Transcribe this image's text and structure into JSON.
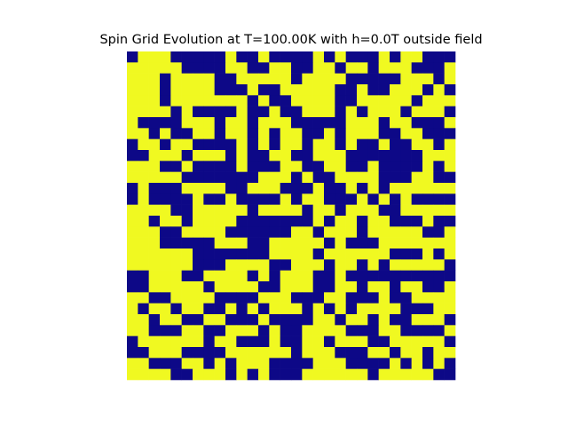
{
  "chart_data": {
    "type": "heatmap",
    "title": "Spin Grid Evolution at T=100.00K with h=0.0T outside field",
    "xlabel": "",
    "ylabel": "",
    "grid": false,
    "legend": "none",
    "axes_visible": false,
    "rows": 30,
    "cols": 30,
    "value_encoding": {
      "1": "spin up",
      "-1": "spin down"
    },
    "colors": {
      "1": "#f0f921",
      "-1": "#0d0887"
    },
    "values": [
      [
        -1,
        1,
        1,
        1,
        -1,
        -1,
        -1,
        -1,
        -1,
        1,
        -1,
        -1,
        1,
        -1,
        -1,
        -1,
        -1,
        1,
        -1,
        1,
        -1,
        -1,
        -1,
        1,
        -1,
        1,
        1,
        -1,
        -1,
        -1
      ],
      [
        1,
        1,
        1,
        1,
        1,
        -1,
        -1,
        -1,
        -1,
        1,
        1,
        -1,
        -1,
        1,
        1,
        -1,
        -1,
        1,
        1,
        -1,
        1,
        1,
        -1,
        1,
        1,
        1,
        -1,
        -1,
        -1,
        1
      ],
      [
        1,
        1,
        1,
        -1,
        1,
        1,
        1,
        1,
        -1,
        -1,
        1,
        1,
        1,
        1,
        1,
        -1,
        1,
        1,
        1,
        1,
        -1,
        -1,
        -1,
        -1,
        -1,
        1,
        1,
        1,
        -1,
        1
      ],
      [
        1,
        1,
        1,
        -1,
        1,
        1,
        1,
        1,
        -1,
        -1,
        -1,
        1,
        -1,
        -1,
        1,
        1,
        1,
        1,
        1,
        -1,
        -1,
        1,
        -1,
        -1,
        1,
        1,
        1,
        -1,
        1,
        -1
      ],
      [
        1,
        1,
        1,
        -1,
        1,
        1,
        1,
        1,
        1,
        1,
        1,
        -1,
        1,
        -1,
        -1,
        1,
        1,
        1,
        1,
        -1,
        -1,
        1,
        1,
        1,
        1,
        1,
        -1,
        1,
        1,
        1
      ],
      [
        1,
        1,
        1,
        1,
        -1,
        1,
        -1,
        -1,
        -1,
        -1,
        1,
        -1,
        -1,
        1,
        -1,
        -1,
        1,
        1,
        1,
        -1,
        1,
        -1,
        1,
        1,
        1,
        -1,
        1,
        1,
        1,
        -1
      ],
      [
        1,
        -1,
        -1,
        -1,
        -1,
        1,
        1,
        1,
        -1,
        1,
        1,
        -1,
        1,
        1,
        1,
        -1,
        -1,
        -1,
        -1,
        -1,
        1,
        1,
        1,
        -1,
        1,
        1,
        -1,
        -1,
        -1,
        1
      ],
      [
        1,
        1,
        -1,
        1,
        -1,
        -1,
        1,
        1,
        -1,
        1,
        1,
        -1,
        1,
        -1,
        1,
        1,
        -1,
        -1,
        1,
        -1,
        1,
        1,
        1,
        -1,
        -1,
        1,
        1,
        -1,
        -1,
        -1
      ],
      [
        -1,
        1,
        1,
        -1,
        1,
        1,
        -1,
        -1,
        -1,
        -1,
        1,
        -1,
        1,
        -1,
        1,
        1,
        -1,
        1,
        1,
        -1,
        1,
        -1,
        -1,
        1,
        -1,
        -1,
        1,
        1,
        -1,
        1
      ],
      [
        -1,
        -1,
        1,
        1,
        1,
        -1,
        1,
        1,
        1,
        -1,
        1,
        -1,
        -1,
        1,
        1,
        -1,
        -1,
        1,
        1,
        1,
        -1,
        -1,
        -1,
        -1,
        -1,
        -1,
        -1,
        1,
        1,
        1
      ],
      [
        1,
        1,
        1,
        -1,
        -1,
        1,
        -1,
        -1,
        -1,
        -1,
        1,
        -1,
        -1,
        -1,
        1,
        1,
        -1,
        -1,
        1,
        1,
        -1,
        -1,
        1,
        -1,
        -1,
        -1,
        -1,
        1,
        -1,
        1
      ],
      [
        1,
        1,
        1,
        1,
        1,
        -1,
        -1,
        -1,
        -1,
        -1,
        -1,
        -1,
        1,
        1,
        1,
        -1,
        1,
        -1,
        -1,
        1,
        1,
        1,
        1,
        -1,
        -1,
        -1,
        1,
        1,
        -1,
        -1
      ],
      [
        -1,
        1,
        -1,
        -1,
        -1,
        1,
        1,
        1,
        1,
        -1,
        -1,
        1,
        1,
        1,
        -1,
        -1,
        -1,
        1,
        -1,
        -1,
        1,
        -1,
        1,
        -1,
        1,
        1,
        1,
        1,
        1,
        1
      ],
      [
        -1,
        1,
        -1,
        -1,
        -1,
        -1,
        1,
        -1,
        -1,
        1,
        -1,
        -1,
        -1,
        -1,
        1,
        -1,
        1,
        1,
        -1,
        -1,
        -1,
        1,
        -1,
        1,
        -1,
        1,
        -1,
        -1,
        -1,
        -1
      ],
      [
        1,
        1,
        1,
        1,
        -1,
        -1,
        1,
        1,
        1,
        1,
        1,
        -1,
        1,
        1,
        1,
        1,
        -1,
        1,
        1,
        -1,
        1,
        1,
        1,
        -1,
        -1,
        1,
        1,
        1,
        1,
        1
      ],
      [
        1,
        1,
        -1,
        1,
        1,
        -1,
        1,
        1,
        1,
        1,
        -1,
        -1,
        -1,
        -1,
        -1,
        -1,
        -1,
        1,
        -1,
        1,
        1,
        -1,
        1,
        1,
        -1,
        -1,
        -1,
        1,
        -1,
        -1
      ],
      [
        1,
        1,
        1,
        -1,
        -1,
        1,
        1,
        1,
        1,
        -1,
        -1,
        -1,
        -1,
        -1,
        -1,
        1,
        1,
        -1,
        1,
        1,
        1,
        -1,
        1,
        1,
        1,
        1,
        1,
        -1,
        -1,
        1
      ],
      [
        1,
        1,
        1,
        -1,
        -1,
        -1,
        -1,
        -1,
        1,
        1,
        1,
        -1,
        -1,
        1,
        1,
        1,
        1,
        1,
        -1,
        1,
        -1,
        -1,
        -1,
        1,
        1,
        1,
        1,
        1,
        1,
        1
      ],
      [
        1,
        1,
        1,
        1,
        1,
        1,
        -1,
        -1,
        -1,
        -1,
        -1,
        -1,
        -1,
        1,
        1,
        1,
        1,
        -1,
        1,
        1,
        1,
        1,
        1,
        1,
        -1,
        -1,
        -1,
        1,
        -1,
        1
      ],
      [
        1,
        1,
        1,
        1,
        1,
        1,
        -1,
        -1,
        -1,
        1,
        1,
        1,
        1,
        -1,
        -1,
        1,
        1,
        1,
        -1,
        1,
        1,
        -1,
        1,
        -1,
        1,
        1,
        1,
        1,
        1,
        -1
      ],
      [
        -1,
        -1,
        1,
        1,
        1,
        -1,
        -1,
        1,
        1,
        1,
        1,
        -1,
        1,
        -1,
        1,
        1,
        1,
        -1,
        -1,
        1,
        -1,
        -1,
        -1,
        -1,
        -1,
        -1,
        -1,
        -1,
        -1,
        -1
      ],
      [
        -1,
        -1,
        1,
        1,
        1,
        1,
        1,
        -1,
        1,
        1,
        1,
        1,
        -1,
        -1,
        1,
        1,
        1,
        -1,
        -1,
        1,
        1,
        -1,
        1,
        1,
        -1,
        1,
        1,
        -1,
        -1,
        1
      ],
      [
        1,
        1,
        -1,
        -1,
        1,
        1,
        1,
        1,
        -1,
        -1,
        -1,
        -1,
        1,
        1,
        1,
        -1,
        -1,
        -1,
        1,
        1,
        -1,
        -1,
        -1,
        1,
        -1,
        -1,
        1,
        1,
        1,
        1
      ],
      [
        1,
        -1,
        1,
        1,
        -1,
        1,
        1,
        -1,
        -1,
        1,
        -1,
        1,
        -1,
        1,
        1,
        1,
        -1,
        1,
        -1,
        1,
        -1,
        1,
        1,
        1,
        1,
        -1,
        -1,
        -1,
        1,
        1
      ],
      [
        1,
        1,
        -1,
        1,
        1,
        -1,
        -1,
        1,
        1,
        -1,
        -1,
        -1,
        1,
        -1,
        -1,
        -1,
        -1,
        1,
        1,
        -1,
        1,
        1,
        -1,
        1,
        -1,
        -1,
        1,
        1,
        1,
        -1
      ],
      [
        1,
        1,
        -1,
        -1,
        -1,
        1,
        1,
        -1,
        -1,
        1,
        1,
        1,
        -1,
        1,
        -1,
        -1,
        1,
        1,
        1,
        1,
        -1,
        -1,
        -1,
        1,
        1,
        -1,
        -1,
        -1,
        -1,
        1
      ],
      [
        -1,
        1,
        1,
        1,
        1,
        1,
        1,
        -1,
        1,
        1,
        -1,
        -1,
        -1,
        1,
        -1,
        -1,
        1,
        1,
        -1,
        1,
        1,
        1,
        -1,
        -1,
        1,
        1,
        1,
        1,
        1,
        -1
      ],
      [
        -1,
        -1,
        1,
        1,
        1,
        -1,
        -1,
        -1,
        -1,
        1,
        1,
        1,
        1,
        1,
        1,
        -1,
        1,
        1,
        1,
        -1,
        -1,
        -1,
        1,
        1,
        -1,
        1,
        1,
        -1,
        1,
        1
      ],
      [
        1,
        1,
        -1,
        -1,
        -1,
        1,
        1,
        -1,
        1,
        -1,
        1,
        1,
        1,
        -1,
        -1,
        -1,
        -1,
        1,
        1,
        1,
        -1,
        -1,
        -1,
        -1,
        1,
        -1,
        1,
        -1,
        1,
        -1
      ],
      [
        1,
        1,
        1,
        1,
        -1,
        -1,
        1,
        1,
        1,
        -1,
        1,
        -1,
        1,
        -1,
        -1,
        -1,
        1,
        1,
        1,
        1,
        1,
        1,
        -1,
        1,
        1,
        1,
        1,
        1,
        -1,
        -1
      ]
    ]
  }
}
